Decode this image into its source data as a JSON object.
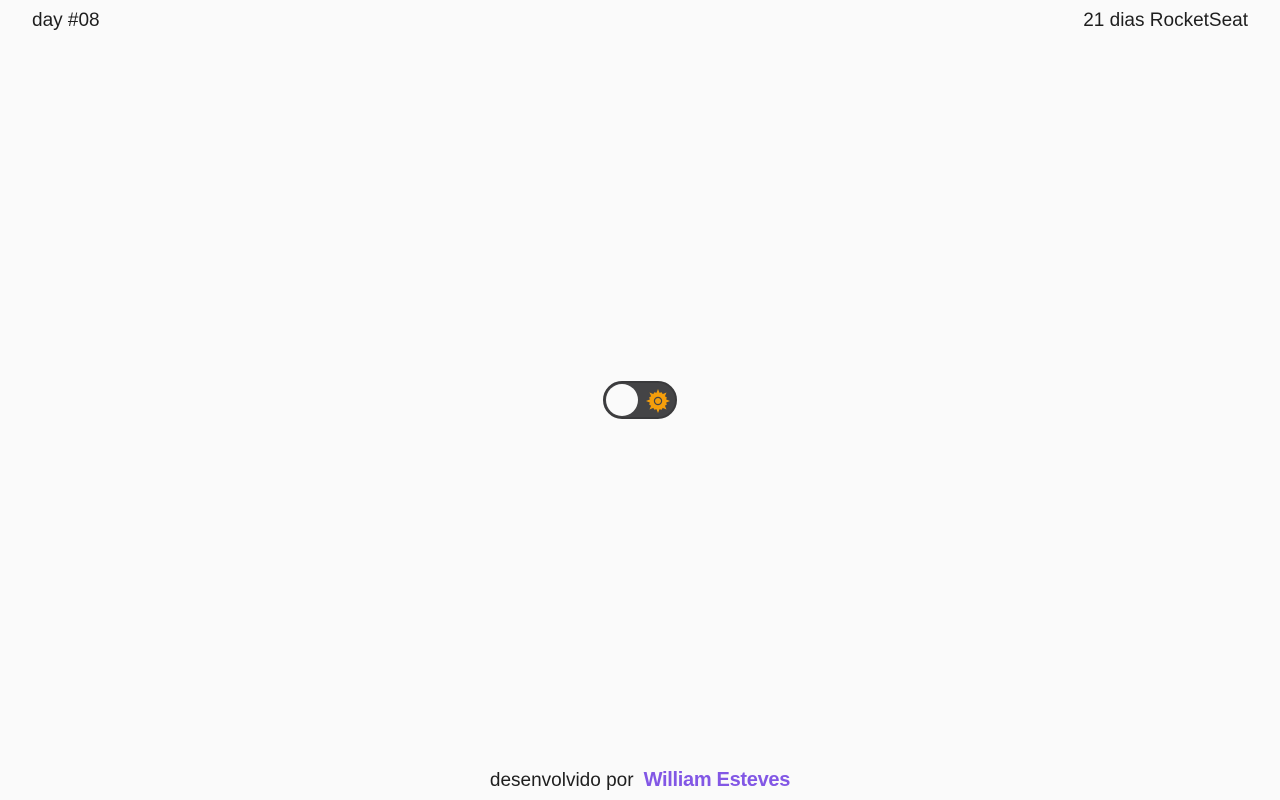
{
  "header": {
    "left_text": "day #08",
    "right_text": "21 dias RocketSeat"
  },
  "theme_toggle": {
    "state": "light",
    "icon": "sun-icon",
    "track_color": "#444446",
    "knob_color": "#fafafa",
    "icon_color": "#f59e0b"
  },
  "footer": {
    "credit_label": "desenvolvido por",
    "author_name": "William Esteves",
    "author_color": "#8257e5"
  }
}
